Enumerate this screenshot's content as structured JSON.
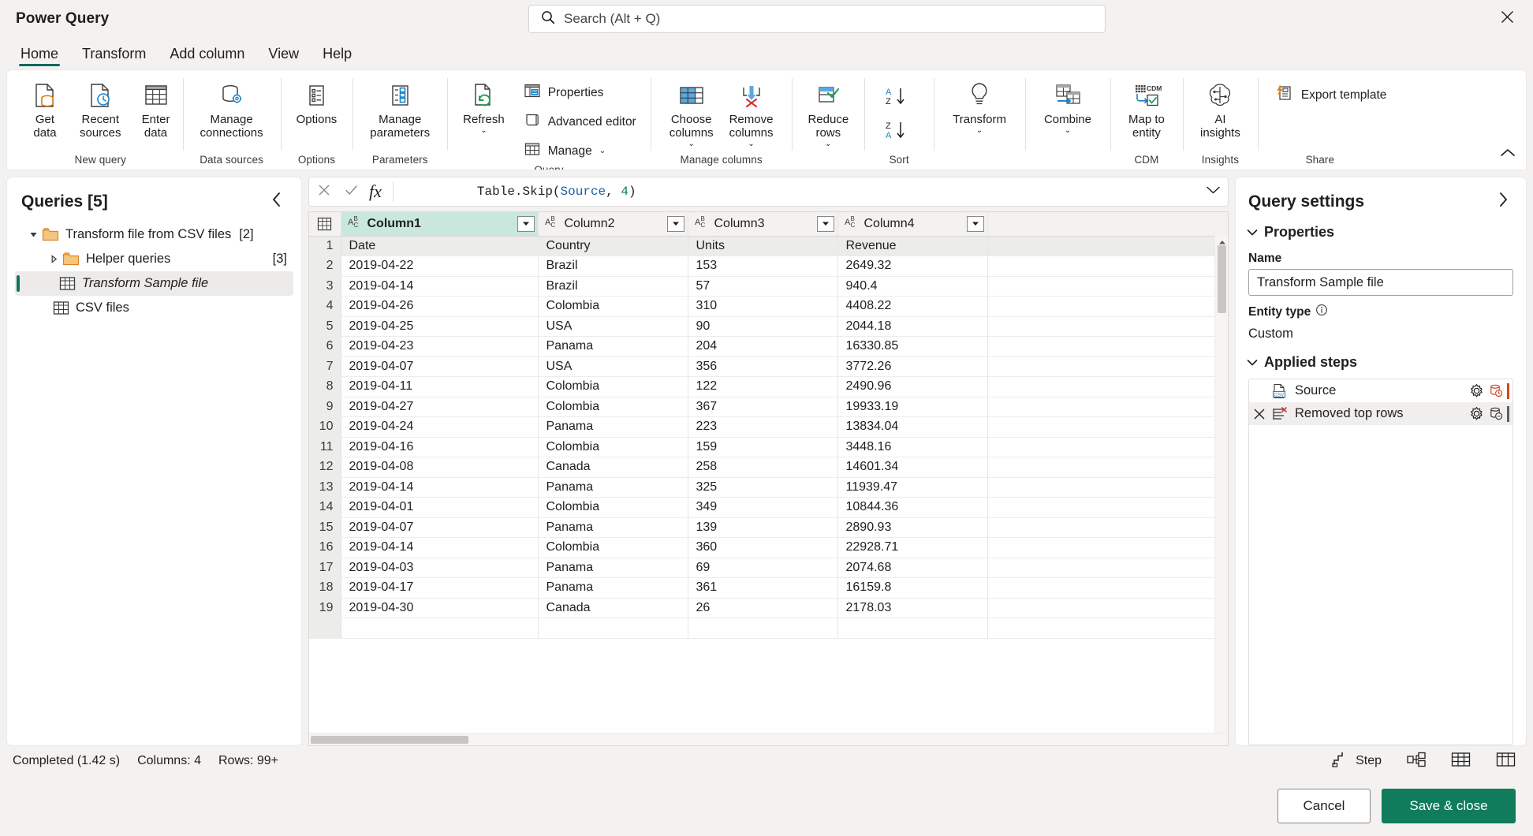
{
  "app": {
    "title": "Power Query"
  },
  "search": {
    "placeholder": "Search (Alt + Q)",
    "value": ""
  },
  "tabs": [
    {
      "label": "Home",
      "active": true
    },
    {
      "label": "Transform",
      "active": false
    },
    {
      "label": "Add column",
      "active": false
    },
    {
      "label": "View",
      "active": false
    },
    {
      "label": "Help",
      "active": false
    }
  ],
  "ribbon": {
    "groups": [
      {
        "name": "New query",
        "label": "New query",
        "buttons": [
          {
            "label": "Get\ndata",
            "caret": true,
            "icon": "get-data-icon"
          },
          {
            "label": "Recent\nsources",
            "caret": true,
            "icon": "recent-sources-icon"
          },
          {
            "label": "Enter\ndata",
            "caret": false,
            "icon": "enter-data-icon"
          }
        ]
      },
      {
        "name": "Data sources",
        "label": "Data sources",
        "buttons": [
          {
            "label": "Manage\nconnections",
            "caret": false,
            "icon": "manage-connections-icon"
          }
        ]
      },
      {
        "name": "Options",
        "label": "Options",
        "buttons": [
          {
            "label": "Options",
            "caret": false,
            "icon": "options-icon"
          }
        ]
      },
      {
        "name": "Parameters",
        "label": "Parameters",
        "buttons": [
          {
            "label": "Manage\nparameters",
            "caret": true,
            "icon": "manage-parameters-icon"
          }
        ]
      },
      {
        "name": "Query",
        "label": "Query",
        "buttons": [
          {
            "label": "Refresh",
            "caret": true,
            "icon": "refresh-icon"
          }
        ],
        "small": [
          {
            "label": "Properties",
            "icon": "properties-icon",
            "caret": false
          },
          {
            "label": "Advanced editor",
            "icon": "advanced-editor-icon",
            "caret": false
          },
          {
            "label": "Manage",
            "icon": "manage-icon",
            "caret": true
          }
        ]
      },
      {
        "name": "Manage columns",
        "label": "Manage columns",
        "buttons": [
          {
            "label": "Choose\ncolumns",
            "caret": true,
            "icon": "choose-columns-icon"
          },
          {
            "label": "Remove\ncolumns",
            "caret": true,
            "icon": "remove-columns-icon"
          }
        ]
      },
      {
        "name": "Reduce rows",
        "label": "",
        "buttons": [
          {
            "label": "Reduce\nrows",
            "caret": true,
            "icon": "reduce-rows-icon"
          }
        ]
      },
      {
        "name": "Sort",
        "label": "Sort",
        "sort": [
          {
            "label": "sort-ascending",
            "icon": "sort-az-icon"
          },
          {
            "label": "sort-descending",
            "icon": "sort-za-icon"
          }
        ]
      },
      {
        "name": "Transform",
        "label": "",
        "buttons": [
          {
            "label": "Transform",
            "caret": true,
            "icon": "transform-bulb-icon"
          }
        ]
      },
      {
        "name": "Combine",
        "label": "",
        "buttons": [
          {
            "label": "Combine",
            "caret": true,
            "icon": "combine-icon"
          }
        ]
      },
      {
        "name": "CDM",
        "label": "CDM",
        "buttons": [
          {
            "label": "Map to\nentity",
            "caret": false,
            "icon": "map-to-entity-icon"
          }
        ]
      },
      {
        "name": "Insights",
        "label": "Insights",
        "buttons": [
          {
            "label": "AI\ninsights",
            "caret": false,
            "icon": "ai-insights-icon"
          }
        ]
      },
      {
        "name": "Share",
        "label": "Share",
        "small": [
          {
            "label": "Export template",
            "icon": "export-template-icon",
            "caret": false
          }
        ]
      }
    ]
  },
  "queries": {
    "title": "Queries [5]",
    "items": [
      {
        "label": "Transform file from CSV files",
        "count": "[2]",
        "type": "folder",
        "indent": 1,
        "expanded": true,
        "selected": false,
        "italic": false
      },
      {
        "label": "Helper queries",
        "count": "[3]",
        "type": "folder",
        "indent": 2,
        "expanded": false,
        "selected": false,
        "italic": false
      },
      {
        "label": "Transform Sample file",
        "count": "",
        "type": "table",
        "indent": 3,
        "expanded": null,
        "selected": true,
        "italic": true
      },
      {
        "label": "CSV files",
        "count": "",
        "type": "table",
        "indent": 2,
        "expanded": null,
        "selected": false,
        "italic": false
      }
    ]
  },
  "formula_bar": {
    "value": "Table.Skip(Source, 4)",
    "tokens": [
      {
        "t": "Table.Skip(",
        "c": "fn"
      },
      {
        "t": "Source",
        "c": "id"
      },
      {
        "t": ", ",
        "c": "fn"
      },
      {
        "t": "4",
        "c": "num"
      },
      {
        "t": ")",
        "c": "fn"
      }
    ]
  },
  "grid": {
    "columns": [
      {
        "name": "Column1",
        "type_icon": "abc-type-icon",
        "selected": true
      },
      {
        "name": "Column2",
        "type_icon": "abc-type-icon",
        "selected": false
      },
      {
        "name": "Column3",
        "type_icon": "abc-type-icon",
        "selected": false
      },
      {
        "name": "Column4",
        "type_icon": "abc-type-icon",
        "selected": false
      }
    ],
    "rows": [
      {
        "n": "1",
        "cells": [
          "Date",
          "Country",
          "Units",
          "Revenue"
        ]
      },
      {
        "n": "2",
        "cells": [
          "2019-04-22",
          "Brazil",
          "153",
          "2649.32"
        ]
      },
      {
        "n": "3",
        "cells": [
          "2019-04-14",
          "Brazil",
          "57",
          "940.4"
        ]
      },
      {
        "n": "4",
        "cells": [
          "2019-04-26",
          "Colombia",
          "310",
          "4408.22"
        ]
      },
      {
        "n": "5",
        "cells": [
          "2019-04-25",
          "USA",
          "90",
          "2044.18"
        ]
      },
      {
        "n": "6",
        "cells": [
          "2019-04-23",
          "Panama",
          "204",
          "16330.85"
        ]
      },
      {
        "n": "7",
        "cells": [
          "2019-04-07",
          "USA",
          "356",
          "3772.26"
        ]
      },
      {
        "n": "8",
        "cells": [
          "2019-04-11",
          "Colombia",
          "122",
          "2490.96"
        ]
      },
      {
        "n": "9",
        "cells": [
          "2019-04-27",
          "Colombia",
          "367",
          "19933.19"
        ]
      },
      {
        "n": "10",
        "cells": [
          "2019-04-24",
          "Panama",
          "223",
          "13834.04"
        ]
      },
      {
        "n": "11",
        "cells": [
          "2019-04-16",
          "Colombia",
          "159",
          "3448.16"
        ]
      },
      {
        "n": "12",
        "cells": [
          "2019-04-08",
          "Canada",
          "258",
          "14601.34"
        ]
      },
      {
        "n": "13",
        "cells": [
          "2019-04-14",
          "Panama",
          "325",
          "11939.47"
        ]
      },
      {
        "n": "14",
        "cells": [
          "2019-04-01",
          "Colombia",
          "349",
          "10844.36"
        ]
      },
      {
        "n": "15",
        "cells": [
          "2019-04-07",
          "Panama",
          "139",
          "2890.93"
        ]
      },
      {
        "n": "16",
        "cells": [
          "2019-04-14",
          "Colombia",
          "360",
          "22928.71"
        ]
      },
      {
        "n": "17",
        "cells": [
          "2019-04-03",
          "Panama",
          "69",
          "2074.68"
        ]
      },
      {
        "n": "18",
        "cells": [
          "2019-04-17",
          "Panama",
          "361",
          "16159.8"
        ]
      },
      {
        "n": "19",
        "cells": [
          "2019-04-30",
          "Canada",
          "26",
          "2178.03"
        ]
      },
      {
        "n": "",
        "cells": [
          "",
          "",
          "",
          ""
        ]
      }
    ]
  },
  "settings": {
    "title": "Query settings",
    "properties_label": "Properties",
    "name_label": "Name",
    "name_value": "Transform Sample file",
    "entity_type_label": "Entity type",
    "entity_type_value": "Custom",
    "applied_steps_label": "Applied steps",
    "steps": [
      {
        "label": "Source",
        "icon": "csv-step-icon",
        "deletable": false,
        "selected": false,
        "bar": "orange"
      },
      {
        "label": "Removed top rows",
        "icon": "removed-rows-step-icon",
        "deletable": true,
        "selected": true,
        "bar": "gray"
      }
    ]
  },
  "status": {
    "completed": "Completed (1.42 s)",
    "columns": "Columns: 4",
    "rows": "Rows: 99+",
    "step_label": "Step"
  },
  "footer": {
    "cancel_label": "Cancel",
    "save_label": "Save & close"
  },
  "colors": {
    "accent_green": "#107c5b",
    "tab_underline": "#11675a",
    "selected_column": "#c9e7df",
    "folder_orange": "#e8a33d",
    "link_blue": "#1d5fa8"
  }
}
